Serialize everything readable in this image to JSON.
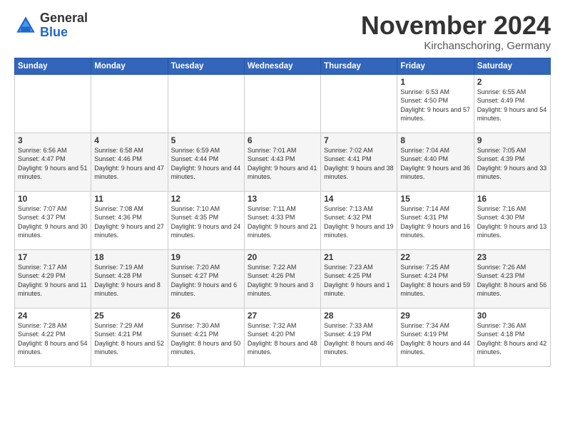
{
  "logo": {
    "general": "General",
    "blue": "Blue"
  },
  "header": {
    "month": "November 2024",
    "location": "Kirchanschoring, Germany"
  },
  "days_of_week": [
    "Sunday",
    "Monday",
    "Tuesday",
    "Wednesday",
    "Thursday",
    "Friday",
    "Saturday"
  ],
  "weeks": [
    [
      {
        "day": "",
        "info": ""
      },
      {
        "day": "",
        "info": ""
      },
      {
        "day": "",
        "info": ""
      },
      {
        "day": "",
        "info": ""
      },
      {
        "day": "",
        "info": ""
      },
      {
        "day": "1",
        "info": "Sunrise: 6:53 AM\nSunset: 4:50 PM\nDaylight: 9 hours and 57 minutes."
      },
      {
        "day": "2",
        "info": "Sunrise: 6:55 AM\nSunset: 4:49 PM\nDaylight: 9 hours and 54 minutes."
      }
    ],
    [
      {
        "day": "3",
        "info": "Sunrise: 6:56 AM\nSunset: 4:47 PM\nDaylight: 9 hours and 51 minutes."
      },
      {
        "day": "4",
        "info": "Sunrise: 6:58 AM\nSunset: 4:46 PM\nDaylight: 9 hours and 47 minutes."
      },
      {
        "day": "5",
        "info": "Sunrise: 6:59 AM\nSunset: 4:44 PM\nDaylight: 9 hours and 44 minutes."
      },
      {
        "day": "6",
        "info": "Sunrise: 7:01 AM\nSunset: 4:43 PM\nDaylight: 9 hours and 41 minutes."
      },
      {
        "day": "7",
        "info": "Sunrise: 7:02 AM\nSunset: 4:41 PM\nDaylight: 9 hours and 38 minutes."
      },
      {
        "day": "8",
        "info": "Sunrise: 7:04 AM\nSunset: 4:40 PM\nDaylight: 9 hours and 36 minutes."
      },
      {
        "day": "9",
        "info": "Sunrise: 7:05 AM\nSunset: 4:39 PM\nDaylight: 9 hours and 33 minutes."
      }
    ],
    [
      {
        "day": "10",
        "info": "Sunrise: 7:07 AM\nSunset: 4:37 PM\nDaylight: 9 hours and 30 minutes."
      },
      {
        "day": "11",
        "info": "Sunrise: 7:08 AM\nSunset: 4:36 PM\nDaylight: 9 hours and 27 minutes."
      },
      {
        "day": "12",
        "info": "Sunrise: 7:10 AM\nSunset: 4:35 PM\nDaylight: 9 hours and 24 minutes."
      },
      {
        "day": "13",
        "info": "Sunrise: 7:11 AM\nSunset: 4:33 PM\nDaylight: 9 hours and 21 minutes."
      },
      {
        "day": "14",
        "info": "Sunrise: 7:13 AM\nSunset: 4:32 PM\nDaylight: 9 hours and 19 minutes."
      },
      {
        "day": "15",
        "info": "Sunrise: 7:14 AM\nSunset: 4:31 PM\nDaylight: 9 hours and 16 minutes."
      },
      {
        "day": "16",
        "info": "Sunrise: 7:16 AM\nSunset: 4:30 PM\nDaylight: 9 hours and 13 minutes."
      }
    ],
    [
      {
        "day": "17",
        "info": "Sunrise: 7:17 AM\nSunset: 4:29 PM\nDaylight: 9 hours and 11 minutes."
      },
      {
        "day": "18",
        "info": "Sunrise: 7:19 AM\nSunset: 4:28 PM\nDaylight: 9 hours and 8 minutes."
      },
      {
        "day": "19",
        "info": "Sunrise: 7:20 AM\nSunset: 4:27 PM\nDaylight: 9 hours and 6 minutes."
      },
      {
        "day": "20",
        "info": "Sunrise: 7:22 AM\nSunset: 4:26 PM\nDaylight: 9 hours and 3 minutes."
      },
      {
        "day": "21",
        "info": "Sunrise: 7:23 AM\nSunset: 4:25 PM\nDaylight: 9 hours and 1 minute."
      },
      {
        "day": "22",
        "info": "Sunrise: 7:25 AM\nSunset: 4:24 PM\nDaylight: 8 hours and 59 minutes."
      },
      {
        "day": "23",
        "info": "Sunrise: 7:26 AM\nSunset: 4:23 PM\nDaylight: 8 hours and 56 minutes."
      }
    ],
    [
      {
        "day": "24",
        "info": "Sunrise: 7:28 AM\nSunset: 4:22 PM\nDaylight: 8 hours and 54 minutes."
      },
      {
        "day": "25",
        "info": "Sunrise: 7:29 AM\nSunset: 4:21 PM\nDaylight: 8 hours and 52 minutes."
      },
      {
        "day": "26",
        "info": "Sunrise: 7:30 AM\nSunset: 4:21 PM\nDaylight: 8 hours and 50 minutes."
      },
      {
        "day": "27",
        "info": "Sunrise: 7:32 AM\nSunset: 4:20 PM\nDaylight: 8 hours and 48 minutes."
      },
      {
        "day": "28",
        "info": "Sunrise: 7:33 AM\nSunset: 4:19 PM\nDaylight: 8 hours and 46 minutes."
      },
      {
        "day": "29",
        "info": "Sunrise: 7:34 AM\nSunset: 4:19 PM\nDaylight: 8 hours and 44 minutes."
      },
      {
        "day": "30",
        "info": "Sunrise: 7:36 AM\nSunset: 4:18 PM\nDaylight: 8 hours and 42 minutes."
      }
    ]
  ]
}
